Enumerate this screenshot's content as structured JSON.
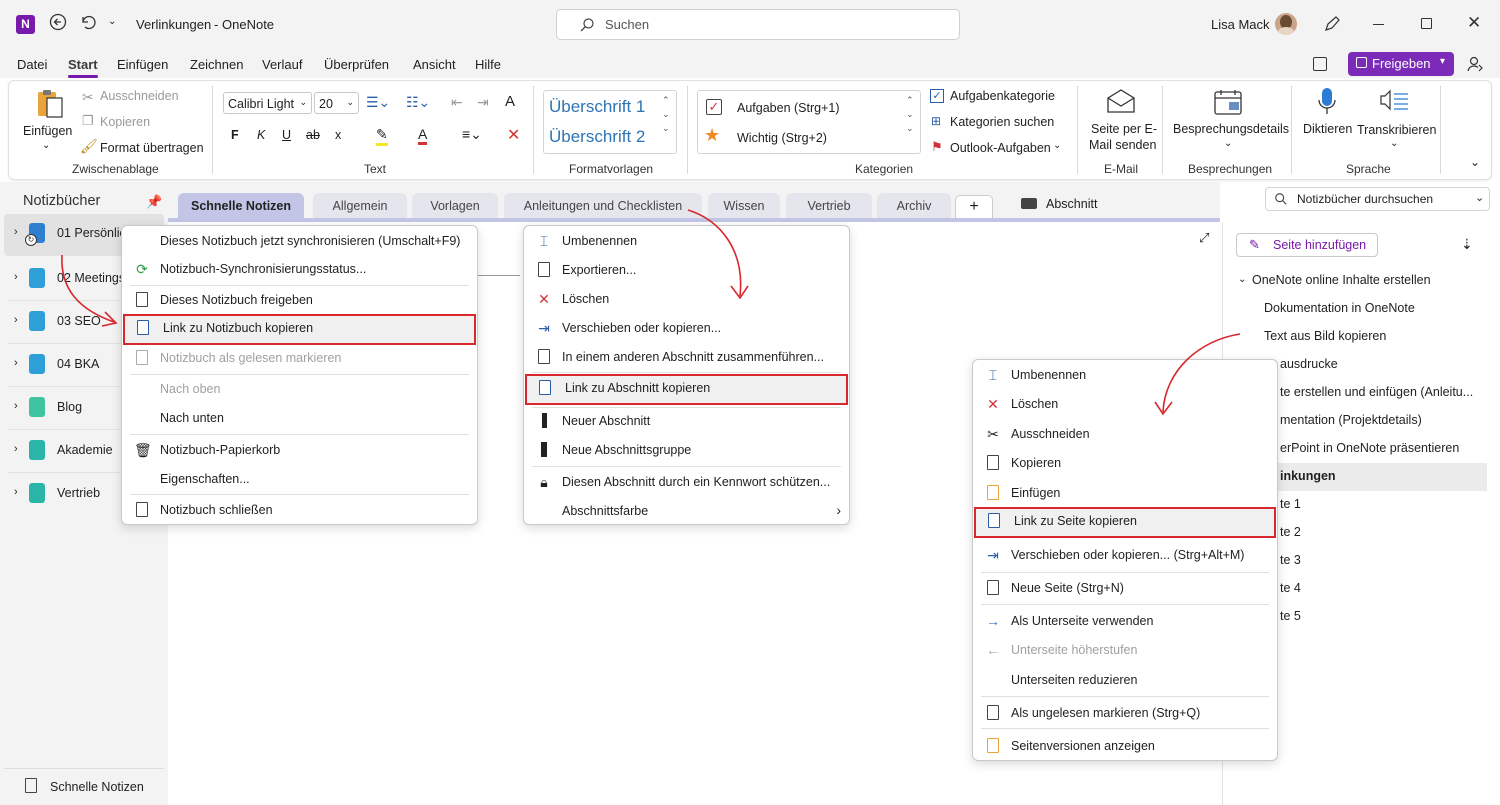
{
  "titlebar": {
    "doc_title": "Verlinkungen",
    "sep": "-",
    "app_name": "OneNote",
    "search_placeholder": "Suchen",
    "user_name": "Lisa Mack"
  },
  "menubar": {
    "items": [
      "Datei",
      "Start",
      "Einfügen",
      "Zeichnen",
      "Verlauf",
      "Überprüfen",
      "Ansicht",
      "Hilfe"
    ],
    "share_label": "Freigeben"
  },
  "ribbon": {
    "clipboard": {
      "paste": "Einfügen",
      "cut": "Ausschneiden",
      "copy": "Kopieren",
      "format_painter": "Format übertragen",
      "group": "Zwischenablage"
    },
    "text": {
      "font": "Calibri Light",
      "size": "20",
      "bold": "F",
      "italic": "K",
      "underline": "U",
      "strike": "ab",
      "sub": "x",
      "group": "Text"
    },
    "styles": {
      "h1": "Überschrift 1",
      "h2": "Überschrift 2",
      "group": "Formatvorlagen"
    },
    "tags": {
      "todo": "Aufgaben (Strg+1)",
      "important": "Wichtig (Strg+2)",
      "category": "Aufgabenkategorie",
      "find": "Kategorien suchen",
      "outlook": "Outlook-Aufgaben",
      "group": "Kategorien"
    },
    "email": {
      "label1": "Seite per E-",
      "label2": "Mail senden",
      "group": "E-Mail"
    },
    "meetings": {
      "label": "Besprechungsdetails",
      "group": "Besprechungen"
    },
    "voice": {
      "dictate": "Diktieren",
      "transcribe": "Transkribieren",
      "group": "Sprache"
    }
  },
  "leftpane": {
    "header": "Notizbücher",
    "notebooks": [
      {
        "name": "01 Persönlic",
        "color": "#2f7fd1"
      },
      {
        "name": "02 Meetings",
        "color": "#2f9fd8"
      },
      {
        "name": "03 SEO",
        "color": "#2f9fd8"
      },
      {
        "name": "04 BKA",
        "color": "#2f9fd8"
      },
      {
        "name": "Blog",
        "color": "#3fc4a2"
      },
      {
        "name": "Akademie",
        "color": "#2ab5a8"
      },
      {
        "name": "Vertrieb",
        "color": "#2ab5a8"
      }
    ],
    "footer": "Schnelle Notizen"
  },
  "tabs": [
    "Schnelle Notizen",
    "Allgemein",
    "Vorlagen",
    "Anleitungen und Checklisten",
    "Wissen",
    "Vertrieb",
    "Archiv"
  ],
  "add_tab": "+",
  "section_label": "Abschnitt",
  "search_notebooks": "Notizbücher durchsuchen",
  "add_page": "Seite hinzufügen",
  "pages": [
    "OneNote online Inhalte erstellen",
    "Dokumentation in OneNote",
    "Text aus Bild kopieren",
    "ausdrucke",
    "te erstellen und einfügen (Anleitu...",
    "mentation (Projektdetails)",
    "erPoint in OneNote präsentieren",
    "inkungen",
    "te 1",
    "te 2",
    "te 3",
    "te 4",
    "te 5"
  ],
  "menu_notebook": [
    {
      "label": "Dieses Notizbuch jetzt synchronisieren  (Umschalt+F9)",
      "icon": "none"
    },
    {
      "label": "Notizbuch-Synchronisierungsstatus...",
      "icon": "sync"
    },
    {
      "label": "Dieses Notizbuch freigeben",
      "icon": "share"
    },
    {
      "label": "Link zu Notizbuch kopieren",
      "icon": "link"
    },
    {
      "label": "Notizbuch als gelesen markieren",
      "icon": "read"
    },
    {
      "label": "Nach oben",
      "icon": "none"
    },
    {
      "label": "Nach unten",
      "icon": "none"
    },
    {
      "label": "Notizbuch-Papierkorb",
      "icon": "trash"
    },
    {
      "label": "Eigenschaften...",
      "icon": "none"
    },
    {
      "label": "Notizbuch schließen",
      "icon": "close"
    }
  ],
  "menu_section": [
    {
      "label": "Umbenennen",
      "icon": "rename"
    },
    {
      "label": "Exportieren...",
      "icon": "export"
    },
    {
      "label": "Löschen",
      "icon": "delete"
    },
    {
      "label": "Verschieben oder kopieren...",
      "icon": "move"
    },
    {
      "label": "In einem anderen Abschnitt zusammenführen...",
      "icon": "merge"
    },
    {
      "label": "Link zu Abschnitt kopieren",
      "icon": "link"
    },
    {
      "label": "Neuer Abschnitt",
      "icon": "section"
    },
    {
      "label": "Neue Abschnittsgruppe",
      "icon": "group"
    },
    {
      "label": "Diesen Abschnitt durch ein Kennwort schützen...",
      "icon": "lock"
    },
    {
      "label": "Abschnittsfarbe",
      "icon": "none"
    }
  ],
  "menu_page": [
    {
      "label": "Umbenennen",
      "icon": "rename"
    },
    {
      "label": "Löschen",
      "icon": "delete"
    },
    {
      "label": "Ausschneiden",
      "icon": "cut"
    },
    {
      "label": "Kopieren",
      "icon": "copy"
    },
    {
      "label": "Einfügen",
      "icon": "paste"
    },
    {
      "label": "Link zu Seite kopieren",
      "icon": "link"
    },
    {
      "label": "Verschieben oder kopieren...  (Strg+Alt+M)",
      "icon": "move"
    },
    {
      "label": "Neue Seite  (Strg+N)",
      "icon": "page"
    },
    {
      "label": "Als Unterseite verwenden",
      "icon": "right"
    },
    {
      "label": "Unterseite höherstufen",
      "icon": "left"
    },
    {
      "label": "Unterseiten reduzieren",
      "icon": "none"
    },
    {
      "label": "Als ungelesen markieren (Strg+Q)",
      "icon": "unread"
    },
    {
      "label": "Seitenversionen anzeigen",
      "icon": "versions"
    }
  ],
  "colors": {
    "accent": "#7719aa",
    "highlight": "#d9272e",
    "tab_bg": "#e5e5ee"
  }
}
